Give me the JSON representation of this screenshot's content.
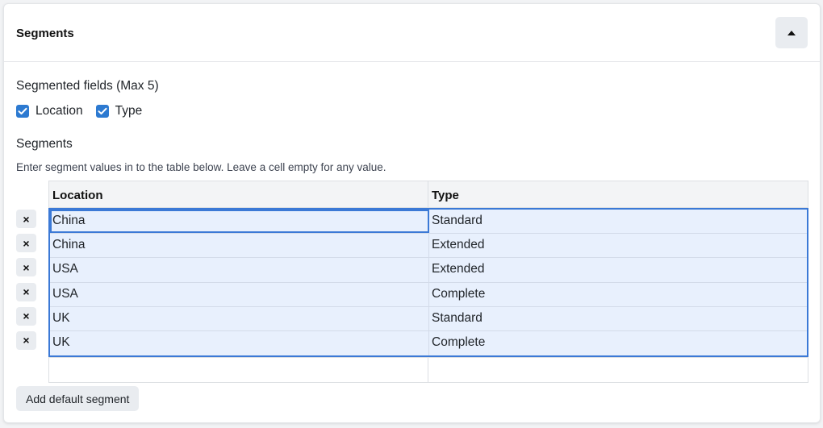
{
  "panel": {
    "title": "Segments",
    "collapse_icon": "caret-up-icon"
  },
  "fields": {
    "label": "Segmented fields (Max 5)",
    "options": [
      {
        "label": "Location",
        "checked": true
      },
      {
        "label": "Type",
        "checked": true
      }
    ]
  },
  "segments": {
    "label": "Segments",
    "hint": "Enter segment values in to the table below. Leave a cell empty for any value.",
    "columns": [
      "Location",
      "Type"
    ],
    "rows": [
      {
        "location": "China",
        "type": "Standard"
      },
      {
        "location": "China",
        "type": "Extended"
      },
      {
        "location": "USA",
        "type": "Extended"
      },
      {
        "location": "USA",
        "type": "Complete"
      },
      {
        "location": "UK",
        "type": "Standard"
      },
      {
        "location": "UK",
        "type": "Complete"
      }
    ],
    "delete_glyph": "×",
    "add_label": "Add default segment"
  },
  "colors": {
    "accent": "#2d7ad1",
    "selection_border": "#3b79d6",
    "selection_fill": "#e8f0fd"
  }
}
